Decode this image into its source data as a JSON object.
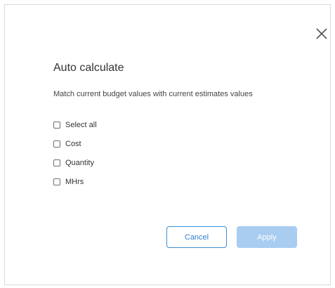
{
  "dialog": {
    "title": "Auto calculate",
    "description": "Match current budget values with current estimates values",
    "close_icon": "close-icon",
    "options": [
      {
        "label": "Select all",
        "checked": false
      },
      {
        "label": "Cost",
        "checked": false
      },
      {
        "label": "Quantity",
        "checked": false
      },
      {
        "label": "MHrs",
        "checked": false
      }
    ],
    "buttons": {
      "cancel_label": "Cancel",
      "apply_label": "Apply",
      "apply_enabled": false
    }
  },
  "colors": {
    "primary": "#2f7fcf",
    "primary_disabled": "#a8cdf0",
    "text": "#333333",
    "border": "#d9d9d9"
  }
}
